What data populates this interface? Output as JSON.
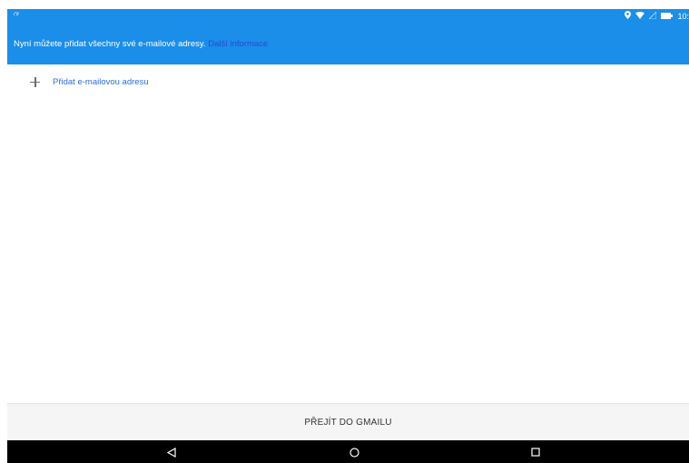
{
  "status_bar": {
    "left_text": "79",
    "time": "10:",
    "icons": [
      "location-icon",
      "wifi-icon",
      "signal-icon",
      "battery-icon"
    ]
  },
  "banner": {
    "text": "Nyní můžete přidat všechny své e-mailové adresy.",
    "link_text": "Další informace",
    "background_color": "#1a8ee8",
    "link_color": "#2b48d8"
  },
  "actions": {
    "add_email_label": "Přidat e-mailovou adresu",
    "add_icon": "plus-icon"
  },
  "footer": {
    "button_label": "PŘEJÍT DO GMAILU"
  },
  "nav_bar": {
    "buttons": [
      "back-icon",
      "home-icon",
      "recents-icon"
    ]
  }
}
